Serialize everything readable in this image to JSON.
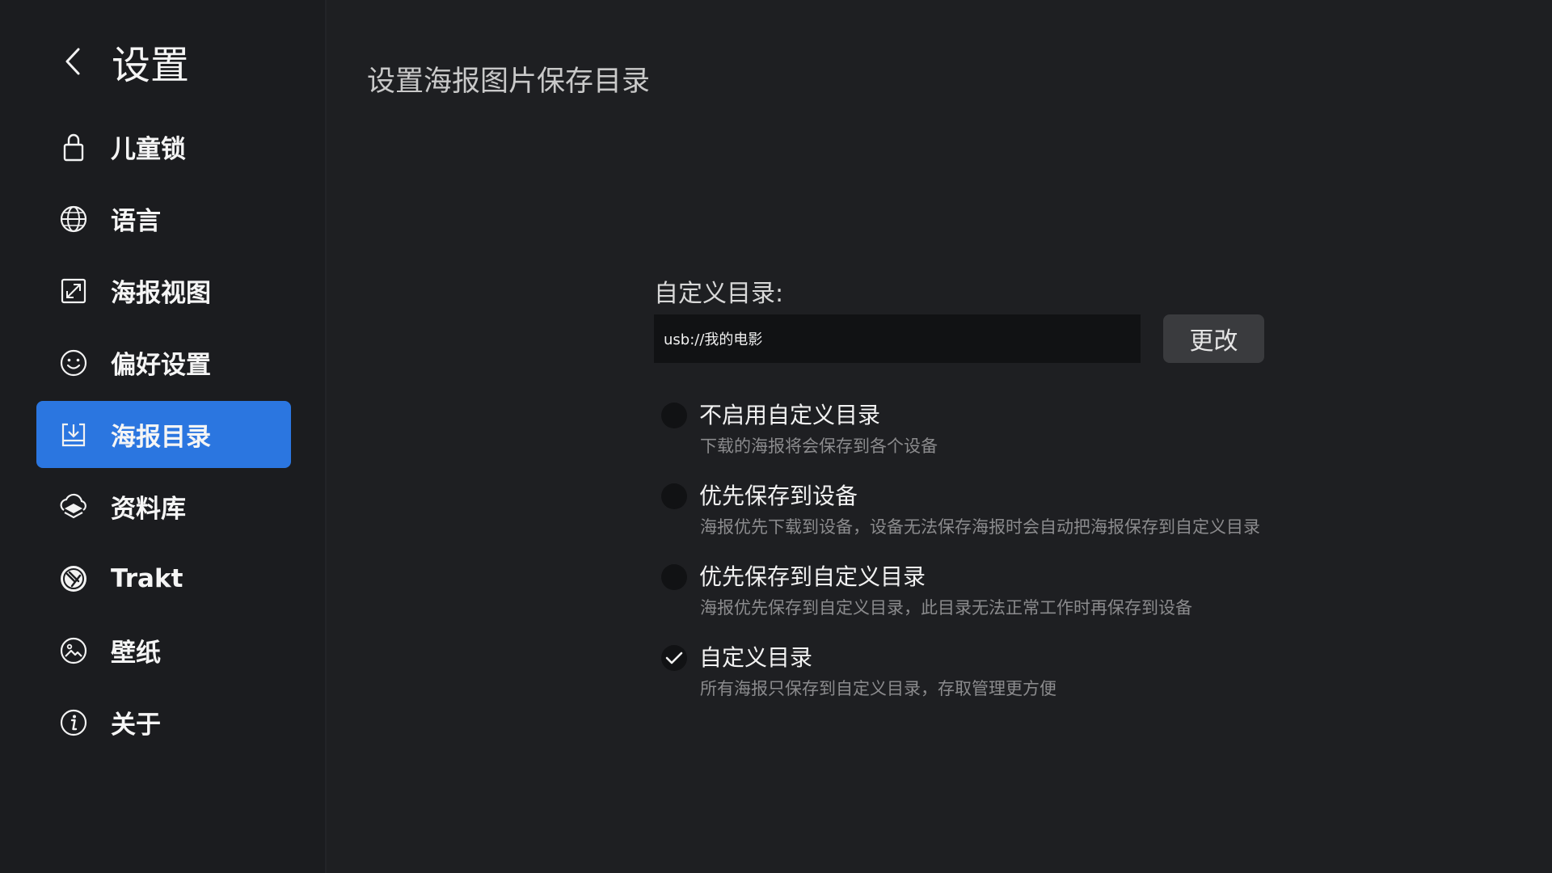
{
  "sidebar": {
    "title": "设置",
    "back_icon": "back-arrow-icon",
    "items": [
      {
        "label": "儿童锁",
        "icon": "lock-icon",
        "active": false
      },
      {
        "label": "语言",
        "icon": "globe-icon",
        "active": false
      },
      {
        "label": "海报视图",
        "icon": "expand-icon",
        "active": false
      },
      {
        "label": "偏好设置",
        "icon": "smiley-icon",
        "active": false
      },
      {
        "label": "海报目录",
        "icon": "download-tray-icon",
        "active": true
      },
      {
        "label": "资料库",
        "icon": "layers-icon",
        "active": false
      },
      {
        "label": "Trakt",
        "icon": "trakt-icon",
        "active": false
      },
      {
        "label": "壁纸",
        "icon": "image-icon",
        "active": false
      },
      {
        "label": "关于",
        "icon": "info-icon",
        "active": false
      }
    ]
  },
  "main": {
    "title": "设置海报图片保存目录",
    "custom_dir_label": "自定义目录:",
    "custom_dir_value": "usb://我的电影",
    "change_button": "更改",
    "options": [
      {
        "title": "不启用自定义目录",
        "desc": "下载的海报将会保存到各个设备",
        "selected": false
      },
      {
        "title": "优先保存到设备",
        "desc": "海报优先下载到设备，设备无法保存海报时会自动把海报保存到自定义目录",
        "selected": false
      },
      {
        "title": "优先保存到自定义目录",
        "desc": "海报优先保存到自定义目录，此目录无法正常工作时再保存到设备",
        "selected": false
      },
      {
        "title": "自定义目录",
        "desc": "所有海报只保存到自定义目录，存取管理更方便",
        "selected": true
      }
    ]
  },
  "colors": {
    "background": "#1e1f22",
    "sidebar": "#1b1c1f",
    "accent": "#2b76e0",
    "input_bg": "#111214",
    "button_bg": "#3a3b3e"
  }
}
